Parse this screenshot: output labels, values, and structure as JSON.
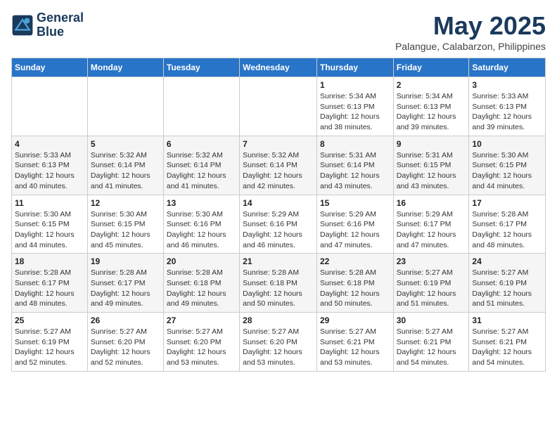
{
  "header": {
    "logo_line1": "General",
    "logo_line2": "Blue",
    "month_year": "May 2025",
    "location": "Palangue, Calabarzon, Philippines"
  },
  "days_of_week": [
    "Sunday",
    "Monday",
    "Tuesday",
    "Wednesday",
    "Thursday",
    "Friday",
    "Saturday"
  ],
  "weeks": [
    [
      {
        "day": "",
        "info": ""
      },
      {
        "day": "",
        "info": ""
      },
      {
        "day": "",
        "info": ""
      },
      {
        "day": "",
        "info": ""
      },
      {
        "day": "1",
        "info": "Sunrise: 5:34 AM\nSunset: 6:13 PM\nDaylight: 12 hours\nand 38 minutes."
      },
      {
        "day": "2",
        "info": "Sunrise: 5:34 AM\nSunset: 6:13 PM\nDaylight: 12 hours\nand 39 minutes."
      },
      {
        "day": "3",
        "info": "Sunrise: 5:33 AM\nSunset: 6:13 PM\nDaylight: 12 hours\nand 39 minutes."
      }
    ],
    [
      {
        "day": "4",
        "info": "Sunrise: 5:33 AM\nSunset: 6:13 PM\nDaylight: 12 hours\nand 40 minutes."
      },
      {
        "day": "5",
        "info": "Sunrise: 5:32 AM\nSunset: 6:14 PM\nDaylight: 12 hours\nand 41 minutes."
      },
      {
        "day": "6",
        "info": "Sunrise: 5:32 AM\nSunset: 6:14 PM\nDaylight: 12 hours\nand 41 minutes."
      },
      {
        "day": "7",
        "info": "Sunrise: 5:32 AM\nSunset: 6:14 PM\nDaylight: 12 hours\nand 42 minutes."
      },
      {
        "day": "8",
        "info": "Sunrise: 5:31 AM\nSunset: 6:14 PM\nDaylight: 12 hours\nand 43 minutes."
      },
      {
        "day": "9",
        "info": "Sunrise: 5:31 AM\nSunset: 6:15 PM\nDaylight: 12 hours\nand 43 minutes."
      },
      {
        "day": "10",
        "info": "Sunrise: 5:30 AM\nSunset: 6:15 PM\nDaylight: 12 hours\nand 44 minutes."
      }
    ],
    [
      {
        "day": "11",
        "info": "Sunrise: 5:30 AM\nSunset: 6:15 PM\nDaylight: 12 hours\nand 44 minutes."
      },
      {
        "day": "12",
        "info": "Sunrise: 5:30 AM\nSunset: 6:15 PM\nDaylight: 12 hours\nand 45 minutes."
      },
      {
        "day": "13",
        "info": "Sunrise: 5:30 AM\nSunset: 6:16 PM\nDaylight: 12 hours\nand 46 minutes."
      },
      {
        "day": "14",
        "info": "Sunrise: 5:29 AM\nSunset: 6:16 PM\nDaylight: 12 hours\nand 46 minutes."
      },
      {
        "day": "15",
        "info": "Sunrise: 5:29 AM\nSunset: 6:16 PM\nDaylight: 12 hours\nand 47 minutes."
      },
      {
        "day": "16",
        "info": "Sunrise: 5:29 AM\nSunset: 6:17 PM\nDaylight: 12 hours\nand 47 minutes."
      },
      {
        "day": "17",
        "info": "Sunrise: 5:28 AM\nSunset: 6:17 PM\nDaylight: 12 hours\nand 48 minutes."
      }
    ],
    [
      {
        "day": "18",
        "info": "Sunrise: 5:28 AM\nSunset: 6:17 PM\nDaylight: 12 hours\nand 48 minutes."
      },
      {
        "day": "19",
        "info": "Sunrise: 5:28 AM\nSunset: 6:17 PM\nDaylight: 12 hours\nand 49 minutes."
      },
      {
        "day": "20",
        "info": "Sunrise: 5:28 AM\nSunset: 6:18 PM\nDaylight: 12 hours\nand 49 minutes."
      },
      {
        "day": "21",
        "info": "Sunrise: 5:28 AM\nSunset: 6:18 PM\nDaylight: 12 hours\nand 50 minutes."
      },
      {
        "day": "22",
        "info": "Sunrise: 5:28 AM\nSunset: 6:18 PM\nDaylight: 12 hours\nand 50 minutes."
      },
      {
        "day": "23",
        "info": "Sunrise: 5:27 AM\nSunset: 6:19 PM\nDaylight: 12 hours\nand 51 minutes."
      },
      {
        "day": "24",
        "info": "Sunrise: 5:27 AM\nSunset: 6:19 PM\nDaylight: 12 hours\nand 51 minutes."
      }
    ],
    [
      {
        "day": "25",
        "info": "Sunrise: 5:27 AM\nSunset: 6:19 PM\nDaylight: 12 hours\nand 52 minutes."
      },
      {
        "day": "26",
        "info": "Sunrise: 5:27 AM\nSunset: 6:20 PM\nDaylight: 12 hours\nand 52 minutes."
      },
      {
        "day": "27",
        "info": "Sunrise: 5:27 AM\nSunset: 6:20 PM\nDaylight: 12 hours\nand 53 minutes."
      },
      {
        "day": "28",
        "info": "Sunrise: 5:27 AM\nSunset: 6:20 PM\nDaylight: 12 hours\nand 53 minutes."
      },
      {
        "day": "29",
        "info": "Sunrise: 5:27 AM\nSunset: 6:21 PM\nDaylight: 12 hours\nand 53 minutes."
      },
      {
        "day": "30",
        "info": "Sunrise: 5:27 AM\nSunset: 6:21 PM\nDaylight: 12 hours\nand 54 minutes."
      },
      {
        "day": "31",
        "info": "Sunrise: 5:27 AM\nSunset: 6:21 PM\nDaylight: 12 hours\nand 54 minutes."
      }
    ]
  ]
}
